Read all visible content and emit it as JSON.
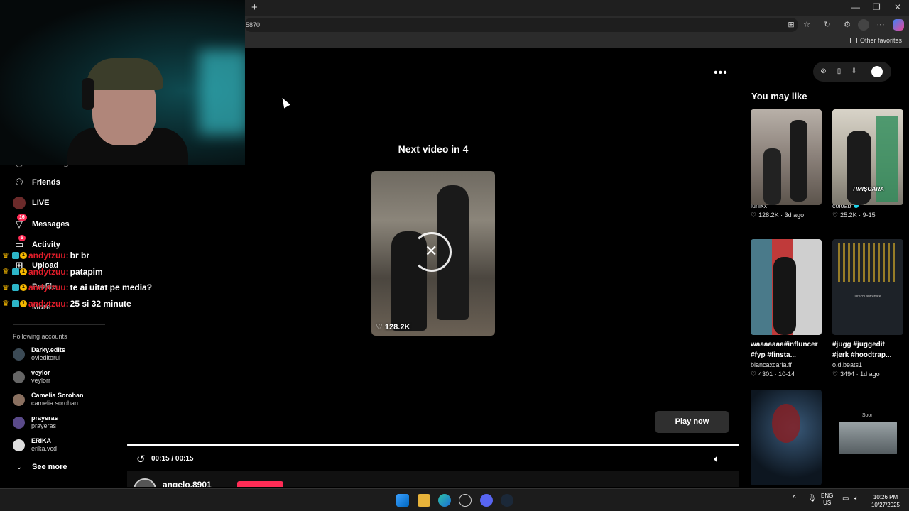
{
  "browser": {
    "new_tab_label": "+",
    "address_fragment": "5870",
    "window_controls": [
      "—",
      "❐",
      "✕"
    ],
    "other_favorites": "Other favorites",
    "toolbar_icons": [
      "apps-icon",
      "star-icon",
      "refresh-icon",
      "extensions-icon",
      "profile-icon",
      "more-icon",
      "copilot-icon"
    ]
  },
  "sidebar": {
    "items": [
      {
        "label": "Following",
        "icon": "following-icon"
      },
      {
        "label": "Friends",
        "icon": "friends-icon"
      },
      {
        "label": "LIVE",
        "icon": "live-icon"
      },
      {
        "label": "Messages",
        "icon": "messages-icon",
        "badge": "16"
      },
      {
        "label": "Activity",
        "icon": "activity-icon",
        "badge": "5"
      },
      {
        "label": "Upload",
        "icon": "upload-icon"
      },
      {
        "label": "Profile",
        "icon": "profile-icon"
      },
      {
        "label": "More",
        "icon": "more-icon"
      }
    ],
    "following_label": "Following accounts",
    "accounts": [
      {
        "name": "Darky.edits",
        "handle": "ovieditorul"
      },
      {
        "name": "veylor",
        "handle": "veylorr"
      },
      {
        "name": "Camelia Sorohan",
        "handle": "camelia.sorohan"
      },
      {
        "name": "prayeras",
        "handle": "prayeras"
      },
      {
        "name": "ERIKA",
        "handle": "erika.vcd"
      }
    ],
    "see_more": "See more"
  },
  "chat": [
    {
      "user": "andytzuu:",
      "message": "br br"
    },
    {
      "user": "andytzuu:",
      "message": "patapim"
    },
    {
      "user": "andytzuu:",
      "message": "te ai uitat pe media?"
    },
    {
      "user": "andytzuu:",
      "message": "25 si 32 minute"
    }
  ],
  "player": {
    "next_video_text": "Next video in 4",
    "next_likes": "128.2K",
    "play_now": "Play now",
    "time": "00:15 / 00:15",
    "progress": 1.0,
    "author_partial": "angelo.8901"
  },
  "recommendations": {
    "title": "You may like",
    "items": [
      {
        "title": "",
        "author": "iunixx",
        "likes": "128.2K",
        "age": "3d ago",
        "verified": false
      },
      {
        "title": "",
        "author": "coloab",
        "likes": "25.2K",
        "age": "9-15",
        "verified": true
      },
      {
        "title": "waaaaaaa#influncer #fyp #finsta...",
        "author": "biancaxcarla.ff",
        "likes": "4301",
        "age": "10-14",
        "verified": false
      },
      {
        "title": "#jugg #juggedit #jerk #hoodtrap...",
        "author": "o.d.beats1",
        "likes": "3494",
        "age": "1d ago",
        "verified": false
      }
    ],
    "soon_label": "Soon",
    "thumb_texts": {
      "timisoara": "TIMIȘOARA",
      "urechi": "Urechi antrenate"
    }
  },
  "taskbar": {
    "lang": "ENG",
    "region": "US",
    "time": "10:26 PM",
    "date": "10/27/2025",
    "apps": [
      "windows-start-icon",
      "file-explorer-icon",
      "edge-icon",
      "chatgpt-icon",
      "discord-icon",
      "steam-icon"
    ]
  }
}
